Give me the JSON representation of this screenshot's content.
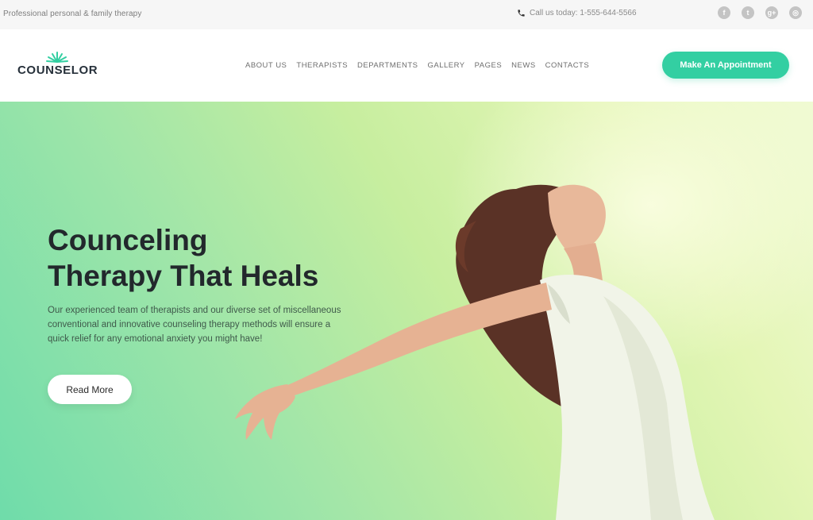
{
  "topbar": {
    "tagline": "Professional personal & family therapy",
    "phone": "Call us today: 1-555-644-5566",
    "socials": [
      {
        "icon": "facebook-icon",
        "glyph": "f"
      },
      {
        "icon": "twitter-icon",
        "glyph": "t"
      },
      {
        "icon": "google-plus-icon",
        "glyph": "g+"
      },
      {
        "icon": "instagram-icon",
        "glyph": "◎"
      }
    ]
  },
  "header": {
    "logo_text": "COUNSELOR",
    "nav": [
      "ABOUT US",
      "THERAPISTS",
      "DEPARTMENTS",
      "GALLERY",
      "PAGES",
      "NEWS",
      "CONTACTS"
    ],
    "cta": "Make An Appointment"
  },
  "hero": {
    "title_line1": "Counceling",
    "title_line2": "Therapy That Heals",
    "description": "Our experienced team of therapists and our diverse set of miscellaneous conventional and innovative counseling therapy methods will ensure a quick relief for any emotional anxiety you might have!",
    "button": "Read More"
  },
  "colors": {
    "accent": "#33cfa2",
    "heading": "#22282c",
    "hero_start": "#6fdcaa",
    "hero_end": "#f0fad3"
  }
}
